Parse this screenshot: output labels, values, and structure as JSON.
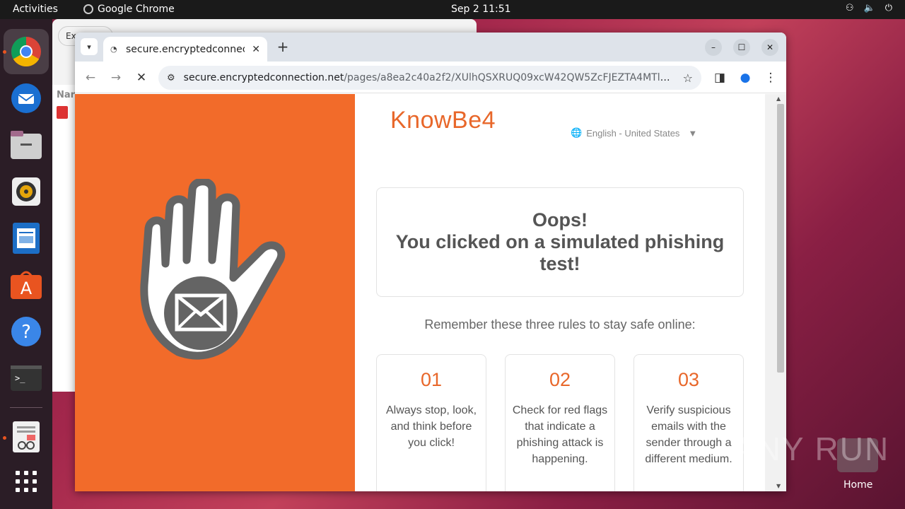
{
  "topbar": {
    "activities": "Activities",
    "app_name": "Google Chrome",
    "clock": "Sep 2  11:51"
  },
  "dock": {
    "items": [
      "chrome",
      "thunderbird",
      "files",
      "rhythmbox",
      "libreoffice-writer",
      "app-center",
      "help",
      "terminal",
      "document-viewer",
      "show-apps"
    ]
  },
  "background_window": {
    "tab_label": "Ex",
    "column_label": "Nar"
  },
  "browser": {
    "tab_title": "secure.encryptedconnec",
    "url_host": "secure.encryptedconnection.net",
    "url_path": "/pages/a8ea2c40a2f2/XUlhQSXRUQ09xcW42QW5ZcFJEZTA4MTlvREd4aF..."
  },
  "page": {
    "logo": "KnowBe4",
    "language": "English - United States",
    "oops_line1": "Oops!",
    "oops_line2": "You clicked on a simulated phishing test!",
    "remember": "Remember these three rules to stay safe online:",
    "rules": [
      {
        "num": "01",
        "text": "Always stop, look, and think before you click!"
      },
      {
        "num": "02",
        "text": "Check for red flags that indicate a phishing attack is happening."
      },
      {
        "num": "03",
        "text": "Verify suspicious emails with the sender through a different medium."
      }
    ]
  },
  "desktop": {
    "watermark": "ANY RUN",
    "home_label": "Home"
  },
  "colors": {
    "accent_orange": "#f26b2a",
    "logo_orange": "#e8672a"
  }
}
